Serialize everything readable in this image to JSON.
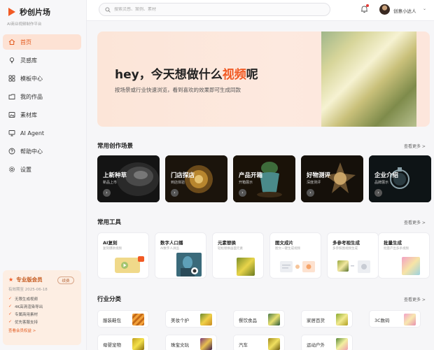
{
  "app": {
    "name": "秒创片场",
    "tagline": "AI商业视频制作平台"
  },
  "nav": [
    {
      "label": "首页",
      "icon": "home-icon",
      "active": true
    },
    {
      "label": "灵感库",
      "icon": "lightbulb-icon",
      "active": false
    },
    {
      "label": "模板中心",
      "icon": "template-grid-icon",
      "active": false
    },
    {
      "label": "我的作品",
      "icon": "folder-icon",
      "active": false
    },
    {
      "label": "素材库",
      "icon": "image-icon",
      "active": false
    },
    {
      "label": "AI Agent",
      "icon": "monitor-icon",
      "active": false
    },
    {
      "label": "帮助中心",
      "icon": "help-icon",
      "active": false
    },
    {
      "label": "设置",
      "icon": "gear-icon",
      "active": false
    }
  ],
  "vip": {
    "title": "专业版会员",
    "renew": "续费",
    "expire": "有效期至 2025-06-18",
    "perks": [
      "无限生成视频",
      "4K高清渲染导出",
      "专属商用素材",
      "优先客服支持"
    ],
    "more": "查看会员权益 >"
  },
  "topbar": {
    "search_placeholder": "搜索灵感、案例、素材",
    "username": "创意小达人",
    "caret": "⌄"
  },
  "hero": {
    "title_pre": "hey，今天想做什么",
    "title_hl": "视频",
    "title_post": "呢",
    "subtitle": "按场景或行业快速浏览，看到喜欢的效果即可生成同款"
  },
  "scenes": {
    "title": "常用创作场景",
    "more": "查看更多 >",
    "items": [
      {
        "name": "上新种草",
        "sub": "新品上市"
      },
      {
        "name": "门店探店",
        "sub": "到店体验"
      },
      {
        "name": "产品开箱",
        "sub": "开箱展示"
      },
      {
        "name": "好物测评",
        "sub": "深度测评"
      },
      {
        "name": "企业介绍",
        "sub": "品牌展示"
      }
    ]
  },
  "tools": {
    "title": "常用工具",
    "more": "查看更多 >",
    "items": [
      {
        "name": "AI复刻",
        "desc": "复刻爆款视频"
      },
      {
        "name": "数字人口播",
        "desc": "AI数字人讲品"
      },
      {
        "name": "元素替换",
        "desc": "轻松替换画面元素"
      },
      {
        "name": "图文成片",
        "desc": "图文一键生成视频"
      },
      {
        "name": "多参考视生成",
        "desc": "多参照图视频生成"
      },
      {
        "name": "批量生成",
        "desc": "批量产出多条视频"
      }
    ]
  },
  "industry": {
    "title": "行业分类",
    "more": "查看更多 >",
    "items": [
      {
        "name": "服装鞋包"
      },
      {
        "name": "美妆个护"
      },
      {
        "name": "餐饮食品"
      },
      {
        "name": "家居百货"
      },
      {
        "name": "3C数码"
      },
      {
        "name": "母婴宠物"
      },
      {
        "name": "珠宝文玩"
      },
      {
        "name": "汽车"
      },
      {
        "name": "运动户外"
      }
    ]
  },
  "colors": {
    "accent": "#f15a24",
    "active_bg": "#fde2d4"
  }
}
